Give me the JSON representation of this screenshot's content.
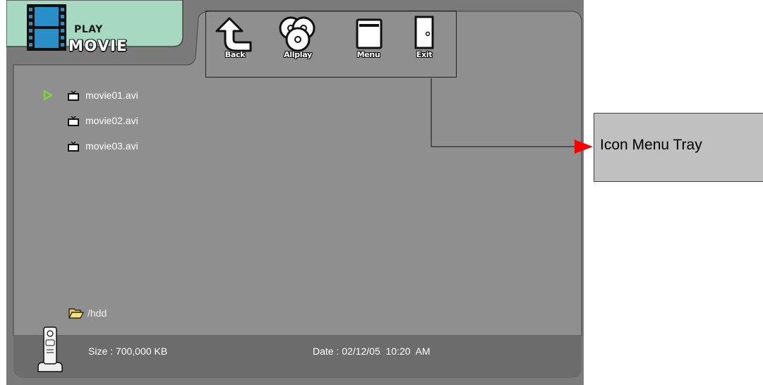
{
  "header": {
    "title_small": "PLAY",
    "title_large": "MOVIE",
    "icon": "film-strip-icon"
  },
  "toolbar": {
    "buttons": [
      {
        "label": "Back",
        "icon": "back-arrow-icon"
      },
      {
        "label": "Allplay",
        "icon": "discs-icon"
      },
      {
        "label": "Menu",
        "icon": "menu-window-icon"
      },
      {
        "label": "Exit",
        "icon": "door-icon"
      }
    ]
  },
  "files": [
    {
      "name": "movie01.avi",
      "selected": true
    },
    {
      "name": "movie02.avi",
      "selected": false
    },
    {
      "name": "movie03.avi",
      "selected": false
    }
  ],
  "path": {
    "text": "/hdd",
    "icon": "open-folder-icon"
  },
  "status": {
    "size": "Size : 700,000 KB",
    "date": "Date : 02/12/05  10:20  AM",
    "device_icon": "remote-control-icon"
  },
  "callout": {
    "label": "Icon Menu Tray"
  },
  "colors": {
    "panel": "#8c8c8c",
    "status_bar": "#6e6e6e",
    "title_tab": "#a6d8c2",
    "selection_arrow": "#7cd43c",
    "callout_arrow": "#ff0000"
  }
}
